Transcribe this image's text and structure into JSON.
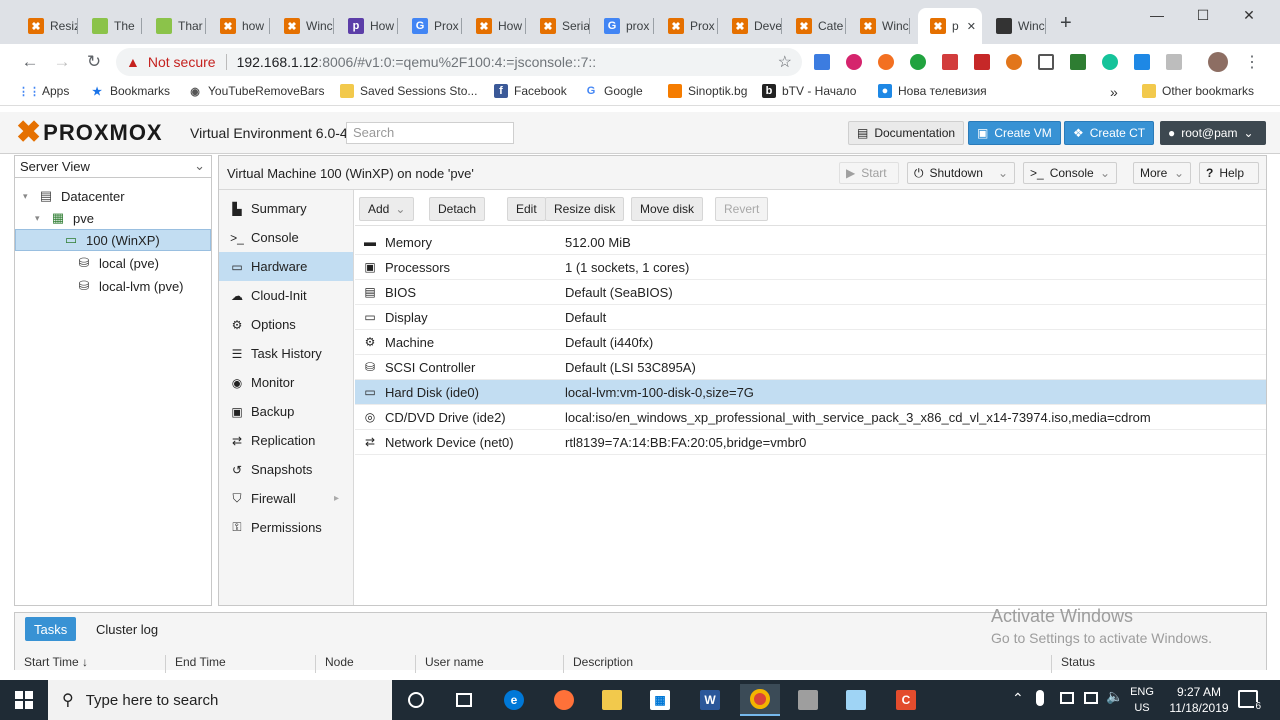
{
  "browser": {
    "tabs": [
      {
        "label": "Resiz",
        "favicon": "proxmox-x-icon",
        "color": "#e57000"
      },
      {
        "label": "The",
        "favicon": "leaf-icon",
        "color": "#8bc34a"
      },
      {
        "label": "Thar",
        "favicon": "leaf-icon",
        "color": "#8bc34a"
      },
      {
        "label": "how",
        "favicon": "proxmox-x-icon",
        "color": "#e57000"
      },
      {
        "label": "Winc",
        "favicon": "proxmox-x-icon",
        "color": "#e57000"
      },
      {
        "label": "How",
        "favicon": "p-icon",
        "color": "#5c3ea8"
      },
      {
        "label": "Prox",
        "favicon": "google-icon",
        "color": "#4285f4"
      },
      {
        "label": "How",
        "favicon": "proxmox-x-icon",
        "color": "#e57000"
      },
      {
        "label": "Seria",
        "favicon": "proxmox-x-icon",
        "color": "#e57000"
      },
      {
        "label": "prox",
        "favicon": "google-icon",
        "color": "#4285f4"
      },
      {
        "label": "Prox",
        "favicon": "proxmox-x-icon",
        "color": "#e57000"
      },
      {
        "label": "Deve",
        "favicon": "proxmox-x-icon",
        "color": "#e57000"
      },
      {
        "label": "Cate",
        "favicon": "proxmox-x-icon",
        "color": "#e57000"
      },
      {
        "label": "Winc",
        "favicon": "proxmox-x-icon",
        "color": "#e57000"
      },
      {
        "label": "p",
        "favicon": "proxmox-x-icon",
        "color": "#e57000",
        "active": true
      },
      {
        "label": "Winc",
        "favicon": "building-icon",
        "color": "#333333"
      }
    ],
    "new_tab": "+",
    "not_secure": "Not secure",
    "url_host": "192.168.1.12",
    "url_rest": ":8006/#v1:0:=qemu%2F100:4:=jsconsole::7::",
    "bookmarks": [
      {
        "label": "Apps",
        "icon": "apps-grid-icon"
      },
      {
        "label": "Bookmarks",
        "icon": "star-icon"
      },
      {
        "label": "YouTubeRemoveBars",
        "icon": "globe-icon"
      },
      {
        "label": "Saved Sessions Sto...",
        "icon": "folder-icon"
      },
      {
        "label": "Facebook",
        "icon": "facebook-icon"
      },
      {
        "label": "Google",
        "icon": "google-icon"
      },
      {
        "label": "Sinoptik.bg",
        "icon": "sinoptik-icon"
      },
      {
        "label": "bTV - Начало",
        "icon": "btv-icon"
      },
      {
        "label": "Нова телевизия",
        "icon": "nova-icon"
      }
    ],
    "more_bookmarks": "»",
    "other_bookmarks": "Other bookmarks"
  },
  "proxmox": {
    "logo_text": "PROXMOX",
    "product": "Virtual Environment 6.0-4",
    "search_placeholder": "Search",
    "documentation": "Documentation",
    "create_vm": "Create VM",
    "create_ct": "Create CT",
    "user": "root@pam",
    "view_selector": "Server View",
    "tree": [
      {
        "label": "Datacenter",
        "icon": "datacenter-icon"
      },
      {
        "label": "pve",
        "icon": "node-icon"
      },
      {
        "label": "100 (WinXP)",
        "icon": "vm-running-icon",
        "selected": true
      },
      {
        "label": "local (pve)",
        "icon": "storage-icon"
      },
      {
        "label": "local-lvm (pve)",
        "icon": "storage-icon"
      }
    ],
    "vm_title": "Virtual Machine 100 (WinXP) on node 'pve'",
    "actions": {
      "start": "Start",
      "shutdown": "Shutdown",
      "console": "Console",
      "more": "More",
      "help": "Help"
    },
    "nav": [
      {
        "label": "Summary",
        "icon": "book-icon"
      },
      {
        "label": "Console",
        "icon": "terminal-icon"
      },
      {
        "label": "Hardware",
        "icon": "monitor-icon",
        "selected": true
      },
      {
        "label": "Cloud-Init",
        "icon": "cloud-icon"
      },
      {
        "label": "Options",
        "icon": "gear-icon"
      },
      {
        "label": "Task History",
        "icon": "list-icon"
      },
      {
        "label": "Monitor",
        "icon": "eye-icon"
      },
      {
        "label": "Backup",
        "icon": "floppy-icon"
      },
      {
        "label": "Replication",
        "icon": "retweet-icon"
      },
      {
        "label": "Snapshots",
        "icon": "history-icon"
      },
      {
        "label": "Firewall",
        "icon": "shield-icon"
      },
      {
        "label": "Permissions",
        "icon": "unlock-icon"
      }
    ],
    "hw_buttons": {
      "add": "Add",
      "detach": "Detach",
      "edit": "Edit",
      "resize": "Resize disk",
      "move": "Move disk",
      "revert": "Revert"
    },
    "hardware": [
      {
        "name": "Memory",
        "value": "512.00 MiB",
        "icon": "memory-icon"
      },
      {
        "name": "Processors",
        "value": "1 (1 sockets, 1 cores)",
        "icon": "cpu-icon"
      },
      {
        "name": "BIOS",
        "value": "Default (SeaBIOS)",
        "icon": "microchip-icon"
      },
      {
        "name": "Display",
        "value": "Default",
        "icon": "desktop-icon"
      },
      {
        "name": "Machine",
        "value": "Default (i440fx)",
        "icon": "cogs-icon"
      },
      {
        "name": "SCSI Controller",
        "value": "Default (LSI 53C895A)",
        "icon": "database-icon"
      },
      {
        "name": "Hard Disk (ide0)",
        "value": "local-lvm:vm-100-disk-0,size=7G",
        "icon": "hdd-icon",
        "selected": true
      },
      {
        "name": "CD/DVD Drive (ide2)",
        "value": "local:iso/en_windows_xp_professional_with_service_pack_3_x86_cd_vl_x14-73974.iso,media=cdrom",
        "icon": "cdrom-icon"
      },
      {
        "name": "Network Device (net0)",
        "value": "rtl8139=7A:14:BB:FA:20:05,bridge=vmbr0",
        "icon": "exchange-icon"
      }
    ],
    "log_tabs": {
      "tasks": "Tasks",
      "cluster_log": "Cluster log"
    },
    "log_columns": [
      "Start Time ↓",
      "End Time",
      "Node",
      "User name",
      "Description",
      "Status"
    ]
  },
  "watermark": {
    "line1": "Activate Windows",
    "line2": "Go to Settings to activate Windows."
  },
  "taskbar": {
    "search_placeholder": "Type here to search",
    "lang": "ENG",
    "region": "US",
    "time": "9:27 AM",
    "date": "11/18/2019",
    "notifications": "6"
  },
  "colors": {
    "accent": "#3892d4",
    "brand": "#e57000",
    "selection": "#c2ddf2"
  }
}
